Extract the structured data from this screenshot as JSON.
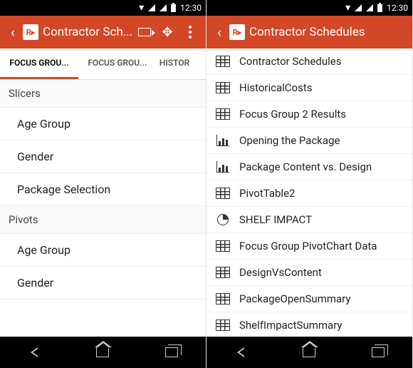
{
  "status": {
    "time": "12:30"
  },
  "left": {
    "title": "Contractor Sch...",
    "tabs": [
      "FOCUS GROU...",
      "FOCUS GROU...",
      "HISTOR"
    ],
    "sections": [
      {
        "header": "Slicers",
        "items": [
          "Age Group",
          "Gender",
          "Package Selection"
        ]
      },
      {
        "header": "Pivots",
        "items": [
          "Age Group",
          "Gender"
        ]
      }
    ]
  },
  "right": {
    "title": "Contractor Schedules",
    "objects": [
      {
        "icon": "table",
        "label": "Contractor Schedules"
      },
      {
        "icon": "table",
        "label": "HistoricalCosts"
      },
      {
        "icon": "table",
        "label": "Focus Group 2 Results"
      },
      {
        "icon": "bar",
        "label": "Opening the Package"
      },
      {
        "icon": "bar",
        "label": "Package Content vs. Design"
      },
      {
        "icon": "table",
        "label": "PivotTable2"
      },
      {
        "icon": "pie",
        "label": "SHELF IMPACT"
      },
      {
        "icon": "table",
        "label": "Focus Group PivotChart Data"
      },
      {
        "icon": "table",
        "label": "DesignVsContent"
      },
      {
        "icon": "table",
        "label": "PackageOpenSummary"
      },
      {
        "icon": "table",
        "label": "ShelfImpactSummary"
      }
    ]
  }
}
